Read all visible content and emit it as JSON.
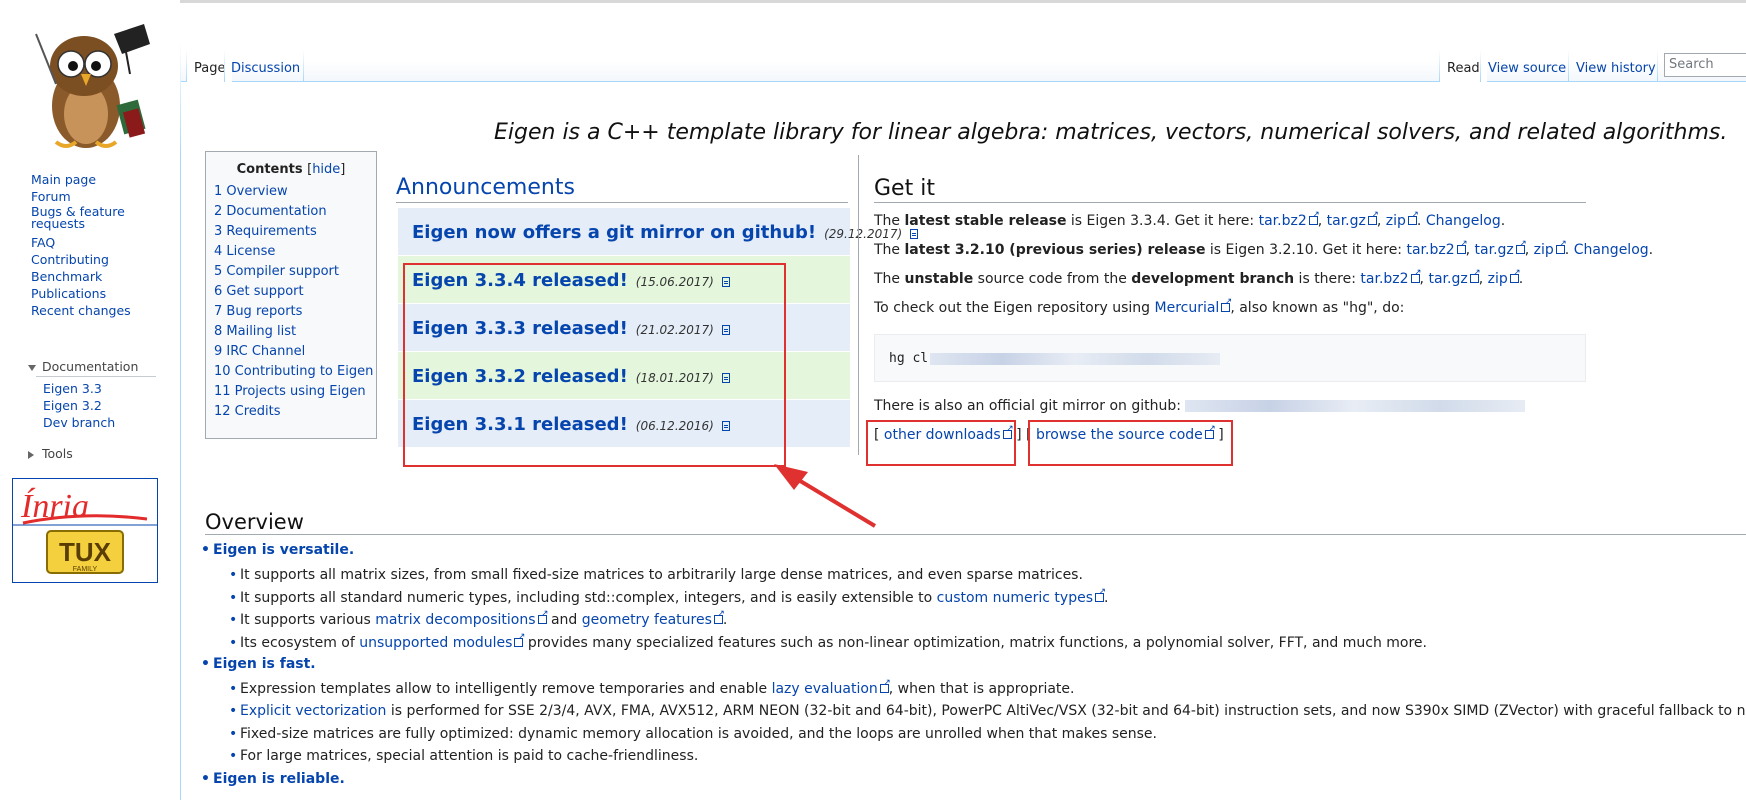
{
  "sidebar": {
    "nav": [
      "Main page",
      "Forum",
      "Bugs & feature requests",
      "FAQ",
      "Contributing",
      "Benchmark",
      "Publications",
      "Recent changes"
    ],
    "documentation_heading": "Documentation",
    "documentation_items": [
      "Eigen 3.3",
      "Eigen 3.2",
      "Dev branch"
    ],
    "tools_heading": "Tools",
    "partner_logos": [
      "Inria",
      "TUX FAMILY"
    ]
  },
  "tabs": {
    "left": [
      "Page",
      "Discussion"
    ],
    "right": [
      "Read",
      "View source",
      "View history"
    ],
    "search_placeholder": "Search"
  },
  "tagline": "Eigen is a C++ template library for linear algebra: matrices, vectors, numerical solvers, and related algorithms.",
  "toc": {
    "title": "Contents",
    "hide_label": "hide",
    "items": [
      "1 Overview",
      "2 Documentation",
      "3 Requirements",
      "4 License",
      "5 Compiler support",
      "6 Get support",
      "7 Bug reports",
      "8 Mailing list",
      "9 IRC Channel",
      "10 Contributing to Eigen",
      "11 Projects using Eigen",
      "12 Credits"
    ]
  },
  "announcements": {
    "title": "Announcements",
    "items": [
      {
        "title": "Eigen now offers a git mirror on github!",
        "date": "(29.12.2017)"
      },
      {
        "title": "Eigen 3.3.4 released!",
        "date": "(15.06.2017)"
      },
      {
        "title": "Eigen 3.3.3 released!",
        "date": "(21.02.2017)"
      },
      {
        "title": "Eigen 3.3.2 released!",
        "date": "(18.01.2017)"
      },
      {
        "title": "Eigen 3.3.1 released!",
        "date": "(06.12.2016)"
      }
    ]
  },
  "getit": {
    "title": "Get it",
    "stable": {
      "prefix": "The ",
      "bold": "latest stable release",
      "middle": " is Eigen 3.3.4. Get it here: ",
      "links": [
        "tar.bz2",
        "tar.gz",
        "zip"
      ],
      "changelog": "Changelog"
    },
    "previous": {
      "prefix": "The ",
      "bold": "latest 3.2.10 (previous series) release",
      "middle": " is Eigen 3.2.10. Get it here: ",
      "links": [
        "tar.bz2",
        "tar.gz",
        "zip"
      ],
      "changelog": "Changelog"
    },
    "unstable": {
      "prefix": "The ",
      "bold1": "unstable",
      "middle1": " source code from the ",
      "bold2": "development branch",
      "middle2": " is there: ",
      "links": [
        "tar.bz2",
        "tar.gz",
        "zip"
      ]
    },
    "checkout_prefix": "To check out the Eigen repository using ",
    "checkout_link": "Mercurial",
    "checkout_suffix": ", also known as \"hg\", do:",
    "code_visible": "hg cl",
    "mirror_text": "There is also an official git mirror on github: ",
    "other_downloads": "other downloads",
    "browse_source": "browse the source code"
  },
  "overview": {
    "title": "Overview",
    "versatile": "Eigen is versatile.",
    "v1": "It supports all matrix sizes, from small fixed-size matrices to arbitrarily large dense matrices, and even sparse matrices.",
    "v2_prefix": "It supports all standard numeric types, including std::complex, integers, and is easily extensible to ",
    "v2_link": "custom numeric types",
    "v3_prefix": "It supports various ",
    "v3_link1": "matrix decompositions",
    "v3_middle": " and ",
    "v3_link2": "geometry features",
    "v4_prefix": "Its ecosystem of ",
    "v4_link": "unsupported modules",
    "v4_suffix": " provides many specialized features such as non-linear optimization, matrix functions, a polynomial solver, FFT, and much more.",
    "fast": "Eigen is fast.",
    "f1_prefix": "Expression templates allow to intelligently remove temporaries and enable ",
    "f1_link": "lazy evaluation",
    "f1_suffix": ", when that is appropriate.",
    "f2_link": "Explicit vectorization",
    "f2_suffix": " is performed for SSE 2/3/4, AVX, FMA, AVX512, ARM NEON (32-bit and 64-bit), PowerPC AltiVec/VSX (32-bit and 64-bit) instruction sets, and now S390x SIMD (ZVector) with graceful fallback to non-vect",
    "f3": "Fixed-size matrices are fully optimized: dynamic memory allocation is avoided, and the loops are unrolled when that makes sense.",
    "f4": "For large matrices, special attention is paid to cache-friendliness.",
    "reliable": "Eigen is reliable."
  }
}
